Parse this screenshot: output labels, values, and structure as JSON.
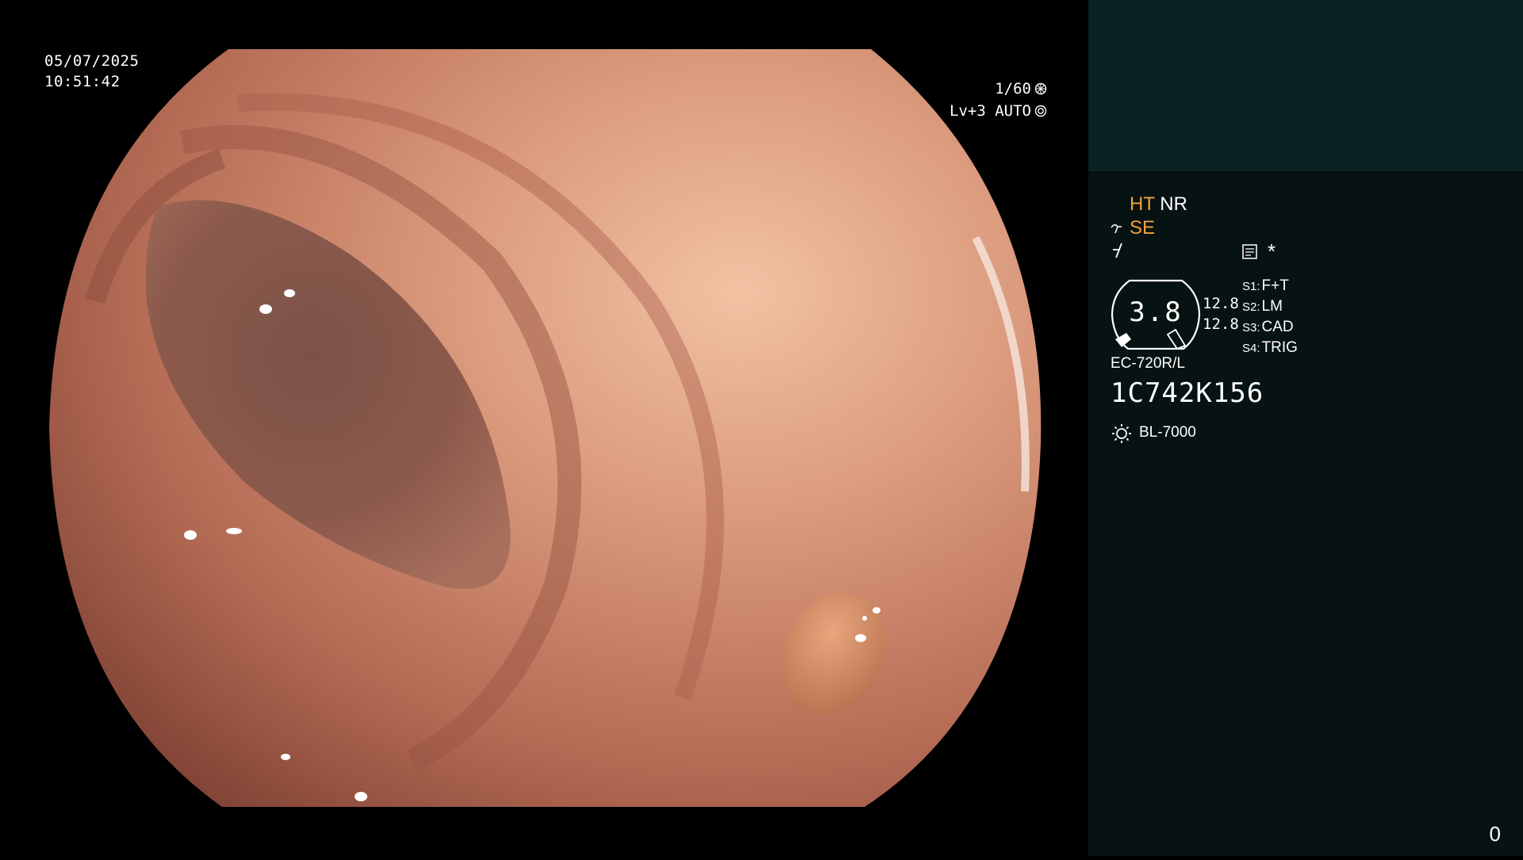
{
  "overlay": {
    "date": "05/07/2025",
    "time": "10:51:42",
    "shutter": "1/60",
    "level_mode": "Lv+3 AUTO"
  },
  "sidebar": {
    "mode_ht": "HT",
    "mode_nr": "NR",
    "mode_se": "SE",
    "star": "*",
    "gauge_value": "3.8",
    "gauge_left_top": "12.8",
    "gauge_left_bottom": "12.8",
    "settings": [
      {
        "key": "S1:",
        "value": "F+T"
      },
      {
        "key": "S2:",
        "value": "LM"
      },
      {
        "key": "S3:",
        "value": "CAD"
      },
      {
        "key": "S4:",
        "value": "TRIG"
      }
    ],
    "scope_model": "EC-720R/L",
    "scope_serial": "1C742K156",
    "light_source": "BL-7000",
    "frame_counter": "0"
  },
  "colors": {
    "accent_orange": "#f0a23c",
    "sidebar_bg": "#071212",
    "sidebar_top_bg": "#0b2222"
  },
  "icons": {
    "shutter": "aperture-icon",
    "auto": "iris-icon",
    "se": "curve-icon",
    "noise": "slash-icon",
    "memo": "document-icon",
    "light": "lamp-sun-icon"
  }
}
